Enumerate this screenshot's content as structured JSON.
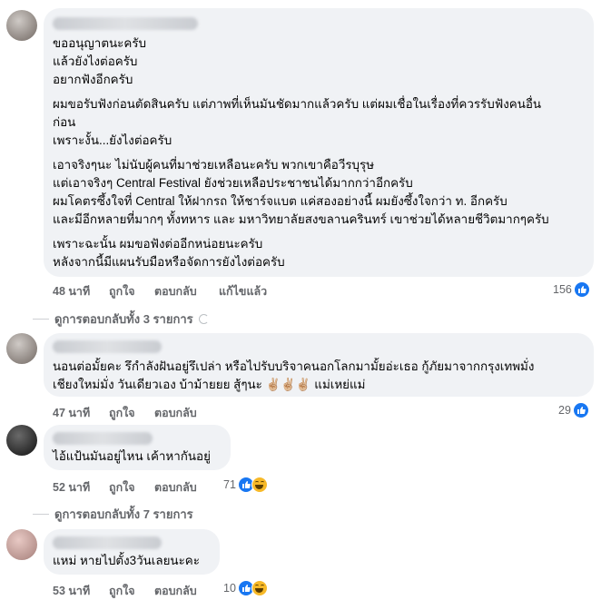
{
  "comments": [
    {
      "lines": [
        "ขออนุญาตนะครับ",
        "แล้วยังไงต่อครับ",
        "อยากฟังอีกครับ",
        "ผมขอรับฟังก่อนตัดสินครับ แต่ภาพที่เห็นมันชัดมากแล้วครับ แต่ผมเชื่อในเรื่องที่ควรรับฟังคนอื่น",
        "ก่อน",
        "เพราะงั้น...ยังไงต่อครับ",
        "เอาจริงๆนะ ไม่นับผู้คนที่มาช่วยเหลือนะครับ พวกเขาคือวีรบุรุษ",
        "แต่เอาจริงๆ Central Festival ยังช่วยเหลือประชาชนได้มากกว่าอีกครับ",
        "ผมโคตรซึ้งใจที่ Central ให้ฝากรถ ให้ชาร์จแบต แค่สองอย่างนี้ ผมยังซึ้งใจกว่า ท. อีกครับ",
        "และมีอีกหลายที่มากๆ ทั้งทหาร และ มหาวิทยาลัยสงขลานครินทร์ เขาช่วยได้หลายชีวิตมากๆครับ",
        "เพราะฉะนั้น ผมขอฟังต่ออีกหน่อยนะครับ",
        "หลังจากนี้มีแผนรับมือหรือจัดการยังไงต่อครับ"
      ],
      "time": "48 นาที",
      "like": "ถูกใจ",
      "reply": "ตอบกลับ",
      "edited": "แก้ไขแล้ว",
      "reaction_count": "156"
    },
    {
      "lines": [
        "นอนต่อมั้ยคะ รึกำลังฝันอยู่รึเปล่า หรือไปรับบริจาคนอกโลกมามั้ยอ่ะเธอ กู้ภัยมาจากกรุงเทพมั่ง",
        "เชียงใหม่มั่ง วันเดียวเอง บ้าม้ายยย สู้ๆนะ ✌🏼✌🏼✌🏼 แม่เหย่แม่"
      ],
      "time": "47 นาที",
      "like": "ถูกใจ",
      "reply": "ตอบกลับ",
      "reaction_count": "29"
    },
    {
      "lines": [
        "ไอ้แป้นมันอยู่ไหน เค้าหากันอยู่"
      ],
      "time": "52 นาที",
      "like": "ถูกใจ",
      "reply": "ตอบกลับ",
      "reaction_count": "71"
    },
    {
      "lines": [
        "แหม่ หายไปตั้ง3วันเลยนะคะ"
      ],
      "time": "53 นาที",
      "like": "ถูกใจ",
      "reply": "ตอบกลับ",
      "reaction_count": "10"
    }
  ],
  "view_replies_1": "ดูการตอบกลับทั้ง 3 รายการ",
  "view_replies_2": "ดูการตอบกลับทั้ง 7 รายการ",
  "colors": {
    "bubble": "#f0f2f5",
    "meta_text": "#65676b",
    "like_blue": "#1877f2",
    "haha_yellow": "#f7b928"
  },
  "icons": [
    "like-icon",
    "haha-icon",
    "thumbs-up-icon"
  ]
}
